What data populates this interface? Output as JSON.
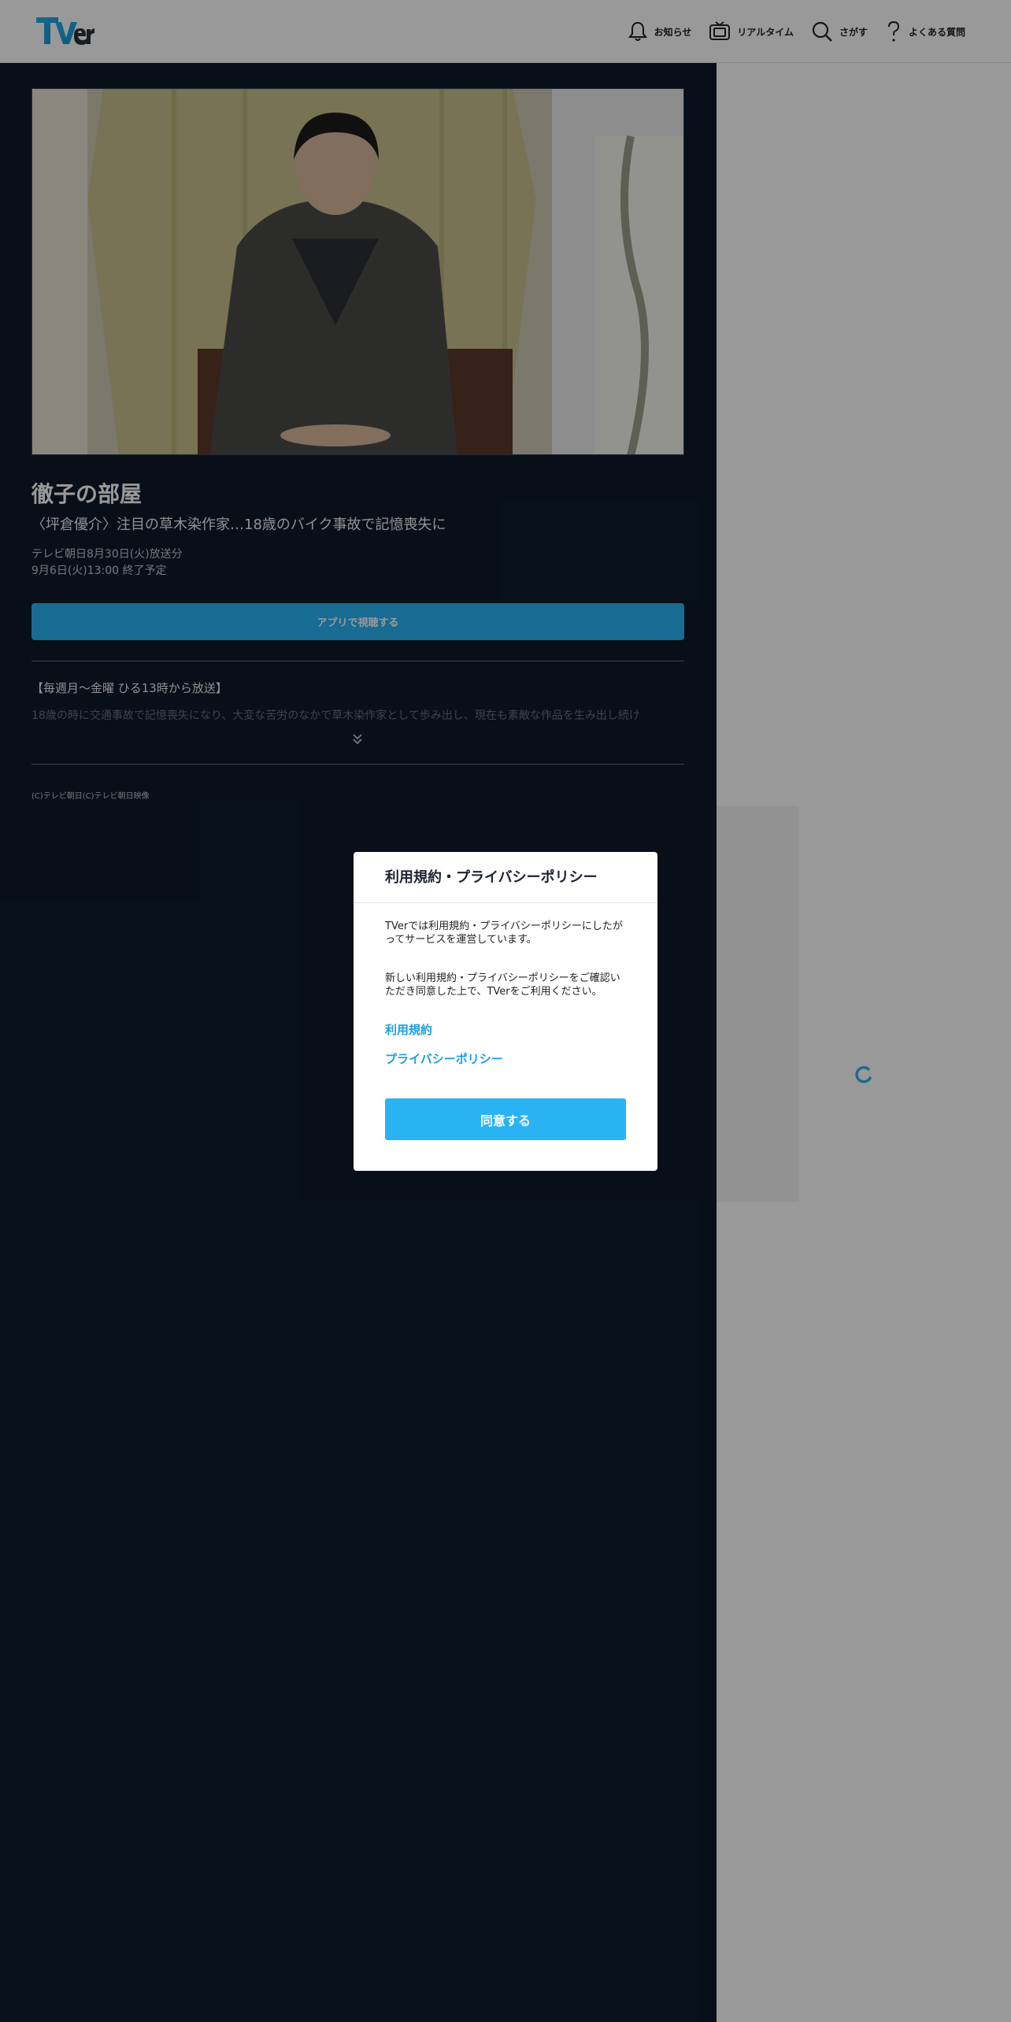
{
  "header": {
    "logo_text": "TVer",
    "nav": [
      {
        "label": "お知らせ",
        "icon": "bell-icon"
      },
      {
        "label": "リアルタイム",
        "icon": "tv-icon"
      },
      {
        "label": "さがす",
        "icon": "search-icon"
      },
      {
        "label": "よくある質問",
        "icon": "question-icon"
      }
    ]
  },
  "program": {
    "title": "徹子の部屋",
    "subtitle": "〈坪倉優介〉注目の草木染作家…18歳のバイク事故で記憶喪失に",
    "broadcast": "テレビ朝日8月30日(火)放送分",
    "end_date": "9月6日(火)13:00 終了予定",
    "app_button": "アプリで視聴する",
    "description_head": "【毎週月～金曜 ひる13時から放送】",
    "description_body": "18歳の時に交通事故で記憶喪失になり、大変な苦労のなかで草木染作家として歩み出し、現在も素敵な作品を生み出し続け",
    "copyright": "(C)テレビ朝日(C)テレビ朝日映像"
  },
  "modal": {
    "title": "利用規約・プライバシーポリシー",
    "text1": "TVerでは利用規約・プライバシーポリシーにしたがってサービスを運営しています。",
    "text2": "新しい利用規約・プライバシーポリシーをご確認いただき同意した上で、TVerをご利用ください。",
    "link_terms": "利用規約",
    "link_privacy": "プライバシーポリシー",
    "agree_button": "同意する"
  },
  "colors": {
    "accent": "#29b3f3",
    "dark_panel": "#0e1a2b",
    "link": "#1aa0e0"
  }
}
